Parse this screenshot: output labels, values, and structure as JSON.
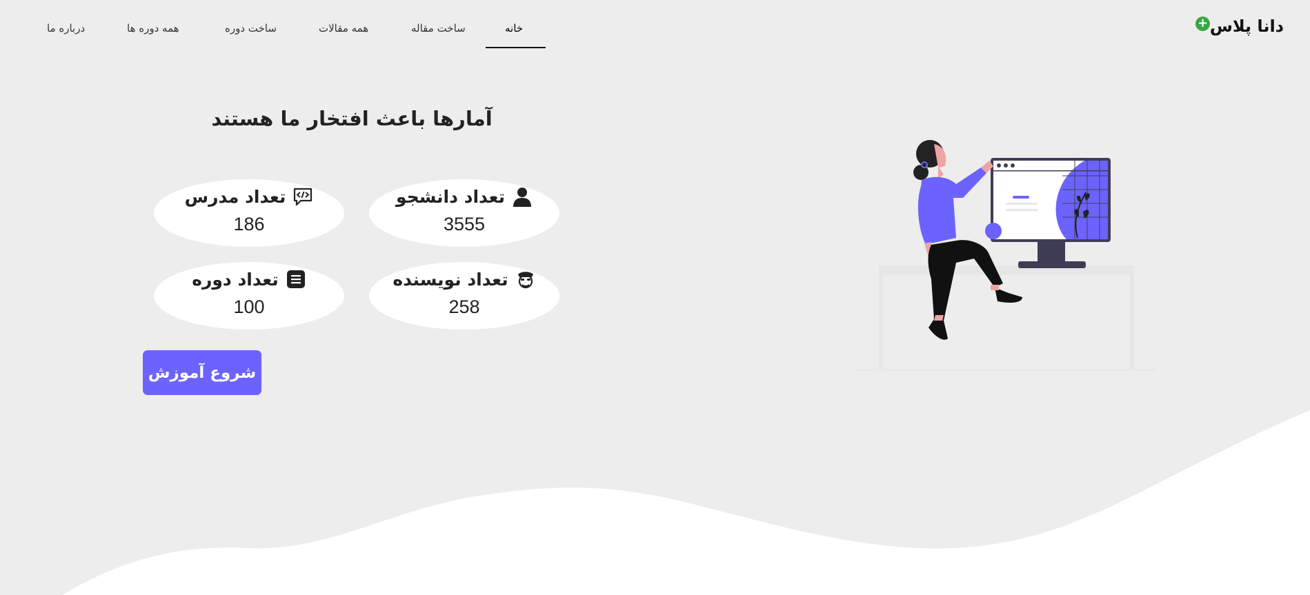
{
  "brand": {
    "name": "دانا پلاس",
    "plus_symbol": "+"
  },
  "nav": {
    "items": [
      {
        "label": "خانه",
        "active": true
      },
      {
        "label": "ساخت مقاله",
        "active": false
      },
      {
        "label": "همه مقالات",
        "active": false
      },
      {
        "label": "ساخت دوره",
        "active": false
      },
      {
        "label": "همه دوره ها",
        "active": false
      },
      {
        "label": "درباره ما",
        "active": false
      }
    ]
  },
  "hero": {
    "headline": "آمارها باعث افتخار ما هستند",
    "cta_label": "شروع آموزش"
  },
  "stats": [
    {
      "title": "تعداد دانشجو",
      "value": "3555",
      "icon": "user-icon"
    },
    {
      "title": "تعداد مدرس",
      "value": "186",
      "icon": "code-chat-icon"
    },
    {
      "title": "تعداد نویسنده",
      "value": "258",
      "icon": "officer-icon"
    },
    {
      "title": "تعداد دوره",
      "value": "100",
      "icon": "list-icon"
    }
  ],
  "colors": {
    "background": "#ededed",
    "accent": "#6c63ff",
    "brand_plus": "#3aa641",
    "wave": "#ffffff"
  }
}
